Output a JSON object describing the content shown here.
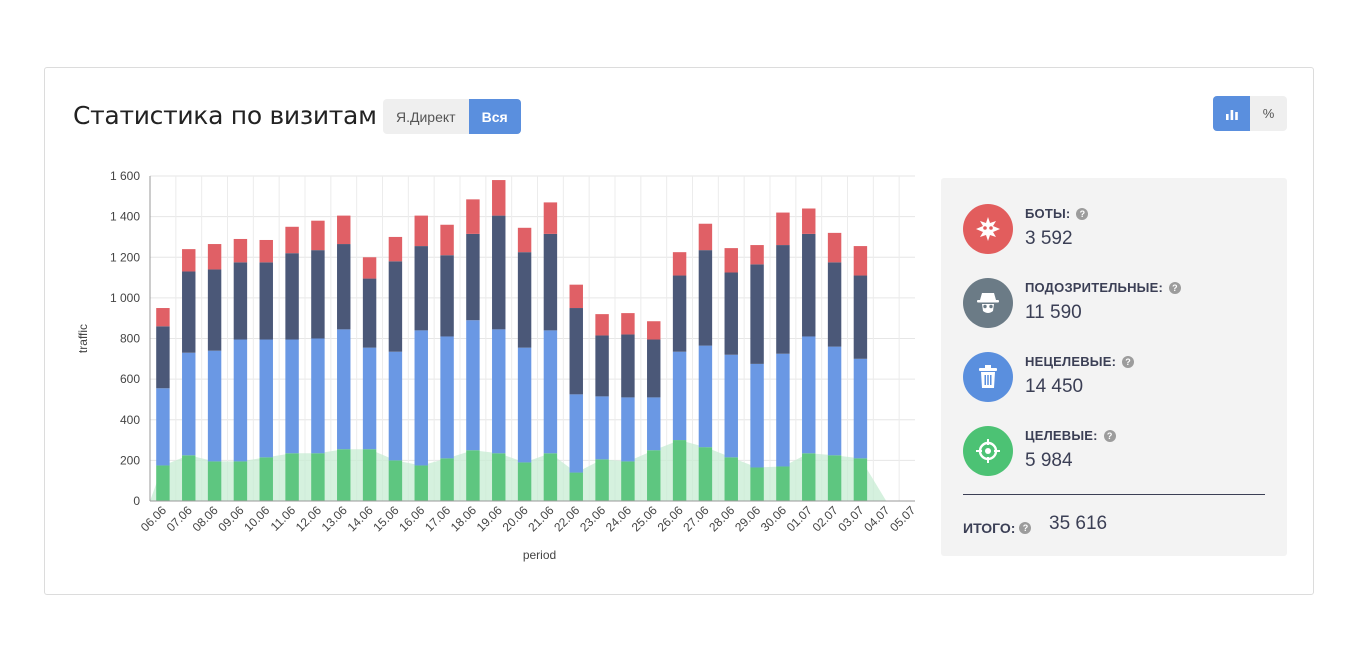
{
  "header": {
    "title": "Статистика по визитам"
  },
  "filter_tabs": [
    {
      "label": "Я.Директ",
      "active": false
    },
    {
      "label": "Вся",
      "active": true
    }
  ],
  "view_modes": [
    {
      "icon": "bar-chart-icon",
      "active": true
    },
    {
      "label": "%",
      "active": false
    }
  ],
  "chart_data": {
    "type": "bar",
    "stacked": true,
    "xlabel": "period",
    "ylabel": "traffic",
    "ylim": [
      0,
      1600
    ],
    "yticks": [
      0,
      200,
      400,
      600,
      800,
      1000,
      1200,
      1400,
      1600
    ],
    "ytick_labels": [
      "0",
      "200",
      "400",
      "600",
      "800",
      "1 000",
      "1 200",
      "1 400",
      "1 600"
    ],
    "grid": true,
    "categories": [
      "06.06",
      "07.06",
      "08.06",
      "09.06",
      "10.06",
      "11.06",
      "12.06",
      "13.06",
      "14.06",
      "15.06",
      "16.06",
      "17.06",
      "18.06",
      "19.06",
      "20.06",
      "21.06",
      "22.06",
      "23.06",
      "24.06",
      "25.06",
      "26.06",
      "27.06",
      "28.06",
      "29.06",
      "30.06",
      "01.07",
      "02.07",
      "03.07",
      "04.07",
      "05.07"
    ],
    "series": [
      {
        "key": "target",
        "color": "#5ec680",
        "values": [
          175,
          225,
          195,
          195,
          215,
          235,
          235,
          255,
          255,
          200,
          175,
          210,
          250,
          235,
          190,
          235,
          140,
          205,
          195,
          250,
          300,
          265,
          215,
          165,
          170,
          235,
          225,
          210,
          0,
          0
        ]
      },
      {
        "key": "nontarget",
        "color": "#6a98e4",
        "values": [
          380,
          505,
          545,
          600,
          580,
          560,
          565,
          590,
          500,
          535,
          665,
          600,
          640,
          610,
          565,
          605,
          385,
          310,
          315,
          260,
          435,
          500,
          505,
          510,
          555,
          575,
          535,
          490,
          0,
          0
        ]
      },
      {
        "key": "suspicious",
        "color": "#4b5878",
        "values": [
          305,
          400,
          400,
          380,
          380,
          425,
          435,
          420,
          340,
          445,
          415,
          400,
          425,
          560,
          470,
          475,
          425,
          300,
          310,
          285,
          375,
          470,
          405,
          490,
          535,
          505,
          415,
          410,
          0,
          0
        ]
      },
      {
        "key": "bots",
        "color": "#e06066",
        "values": [
          90,
          110,
          125,
          115,
          110,
          130,
          145,
          140,
          105,
          120,
          150,
          150,
          170,
          175,
          120,
          155,
          115,
          105,
          105,
          90,
          115,
          130,
          120,
          95,
          160,
          125,
          145,
          145,
          0,
          0
        ]
      }
    ],
    "area_series": {
      "key": "target-area",
      "color": "#c7ecd3",
      "values": [
        175,
        225,
        195,
        195,
        215,
        235,
        235,
        255,
        255,
        200,
        175,
        210,
        250,
        235,
        190,
        235,
        140,
        205,
        195,
        250,
        300,
        265,
        215,
        165,
        170,
        235,
        225,
        210,
        0,
        0
      ]
    }
  },
  "stats": [
    {
      "label": "БОТЫ:",
      "value": "3 592",
      "color": "#e25d5d",
      "icon": "bug-icon"
    },
    {
      "label": "ПОДОЗРИТЕЛЬНЫЕ:",
      "value": "11 590",
      "color": "#6b7b86",
      "icon": "spy-icon"
    },
    {
      "label": "НЕЦЕЛЕВЫЕ:",
      "value": "14 450",
      "color": "#5a8fde",
      "icon": "trash-icon"
    },
    {
      "label": "ЦЕЛЕВЫЕ:",
      "value": "5 984",
      "color": "#4cc274",
      "icon": "target-icon"
    }
  ],
  "total": {
    "label": "ИТОГО:",
    "value": "35 616"
  },
  "help_glyph": "?"
}
